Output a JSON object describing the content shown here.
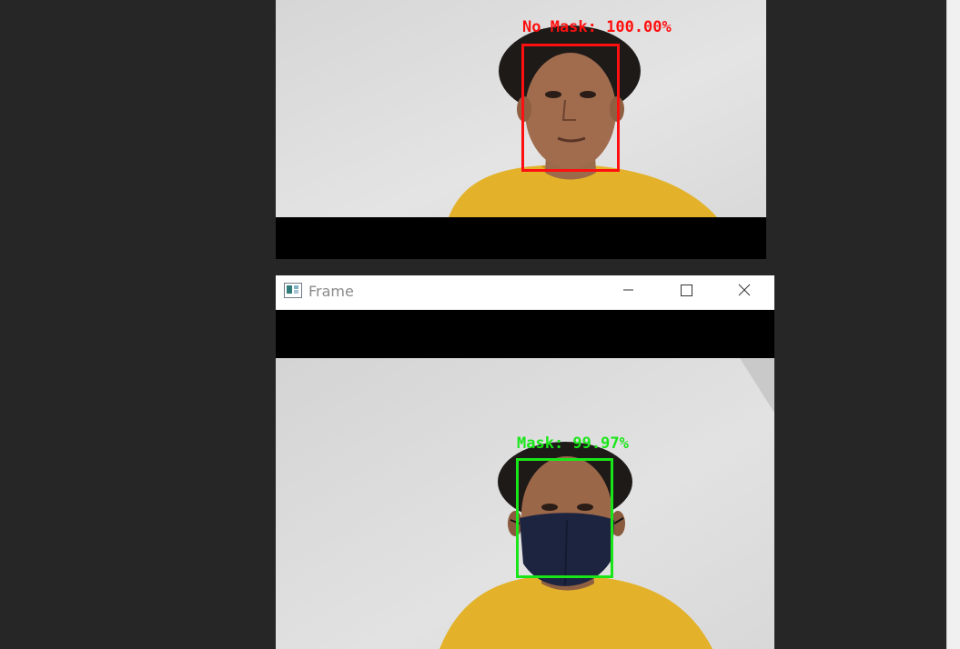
{
  "window_bottom": {
    "title": "Frame",
    "controls": {
      "minimize": "minimize-icon",
      "maximize": "maximize-icon",
      "close": "close-icon"
    }
  },
  "detections": {
    "top": {
      "label": "No Mask: 100.00%",
      "color": "#ff1010"
    },
    "bottom": {
      "label": "Mask: 99.97%",
      "color": "#19e619"
    }
  },
  "colors": {
    "background": "#262626",
    "shirt": "#e3b22a",
    "wall": "#dedede",
    "mask": "#1c2440"
  }
}
